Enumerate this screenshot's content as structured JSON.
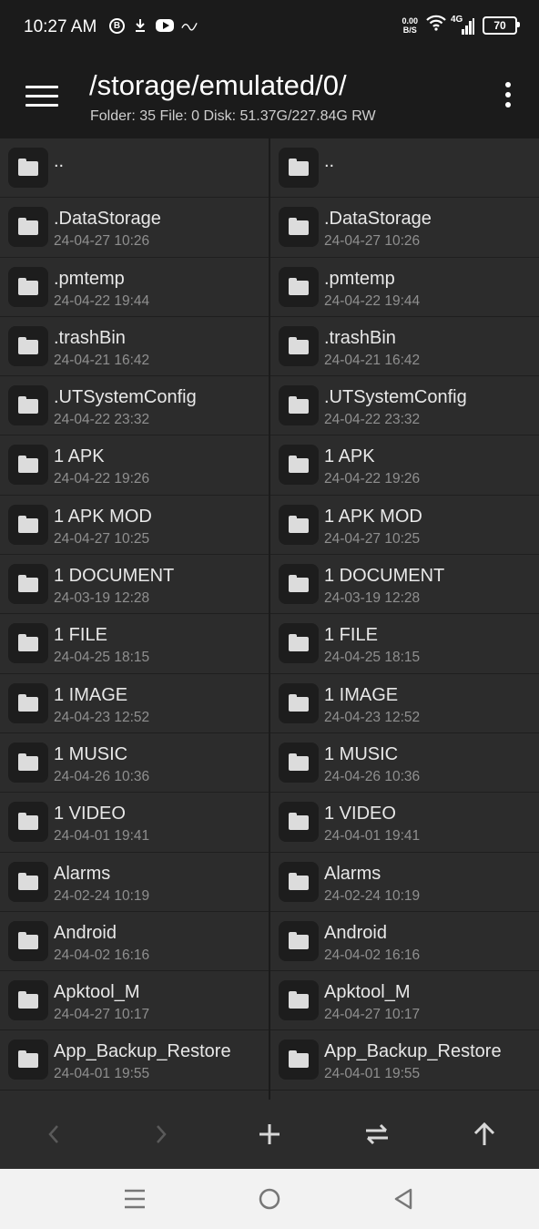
{
  "status_bar": {
    "time": "10:27 AM",
    "net_speed_value": "0.00",
    "net_speed_unit": "B/S",
    "network": "4G",
    "battery": "70",
    "notif_icons": [
      "b-circle-icon",
      "download-icon",
      "youtube-icon",
      "app-logo-icon"
    ]
  },
  "header": {
    "path": "/storage/emulated/0/",
    "info": "Folder: 35  File: 0  Disk: 51.37G/227.84G  RW"
  },
  "left_pane": {
    "items": [
      {
        "name": "..",
        "date": ""
      },
      {
        "name": ".DataStorage",
        "date": "24-04-27 10:26"
      },
      {
        "name": ".pmtemp",
        "date": "24-04-22 19:44"
      },
      {
        "name": ".trashBin",
        "date": "24-04-21 16:42"
      },
      {
        "name": ".UTSystemConfig",
        "date": "24-04-22 23:32"
      },
      {
        "name": "1 APK",
        "date": "24-04-22 19:26"
      },
      {
        "name": "1 APK MOD",
        "date": "24-04-27 10:25"
      },
      {
        "name": "1 DOCUMENT",
        "date": "24-03-19 12:28"
      },
      {
        "name": "1 FILE",
        "date": "24-04-25 18:15"
      },
      {
        "name": "1 IMAGE",
        "date": "24-04-23 12:52"
      },
      {
        "name": "1 MUSIC",
        "date": "24-04-26 10:36"
      },
      {
        "name": "1 VIDEO",
        "date": "24-04-01 19:41"
      },
      {
        "name": "Alarms",
        "date": "24-02-24 10:19"
      },
      {
        "name": "Android",
        "date": "24-04-02 16:16"
      },
      {
        "name": "Apktool_M",
        "date": "24-04-27 10:17"
      },
      {
        "name": "App_Backup_Restore",
        "date": "24-04-01 19:55"
      }
    ]
  },
  "right_pane": {
    "items": [
      {
        "name": "..",
        "date": ""
      },
      {
        "name": ".DataStorage",
        "date": "24-04-27 10:26"
      },
      {
        "name": ".pmtemp",
        "date": "24-04-22 19:44"
      },
      {
        "name": ".trashBin",
        "date": "24-04-21 16:42"
      },
      {
        "name": ".UTSystemConfig",
        "date": "24-04-22 23:32"
      },
      {
        "name": "1 APK",
        "date": "24-04-22 19:26"
      },
      {
        "name": "1 APK MOD",
        "date": "24-04-27 10:25"
      },
      {
        "name": "1 DOCUMENT",
        "date": "24-03-19 12:28"
      },
      {
        "name": "1 FILE",
        "date": "24-04-25 18:15"
      },
      {
        "name": "1 IMAGE",
        "date": "24-04-23 12:52"
      },
      {
        "name": "1 MUSIC",
        "date": "24-04-26 10:36"
      },
      {
        "name": "1 VIDEO",
        "date": "24-04-01 19:41"
      },
      {
        "name": "Alarms",
        "date": "24-02-24 10:19"
      },
      {
        "name": "Android",
        "date": "24-04-02 16:16"
      },
      {
        "name": "Apktool_M",
        "date": "24-04-27 10:17"
      },
      {
        "name": "App_Backup_Restore",
        "date": "24-04-01 19:55"
      }
    ]
  },
  "toolbar": {
    "buttons": [
      "back-icon",
      "forward-icon",
      "add-icon",
      "swap-icon",
      "up-arrow-icon"
    ]
  },
  "navbar": {
    "buttons": [
      "recents-icon",
      "home-icon",
      "back-triangle-icon"
    ]
  },
  "colors": {
    "background": "#1b1b1b",
    "pane": "#2c2c2c",
    "icon_tile": "#1d1d1d",
    "date_text": "#8f8f8f",
    "navbar": "#f2f2f2"
  }
}
